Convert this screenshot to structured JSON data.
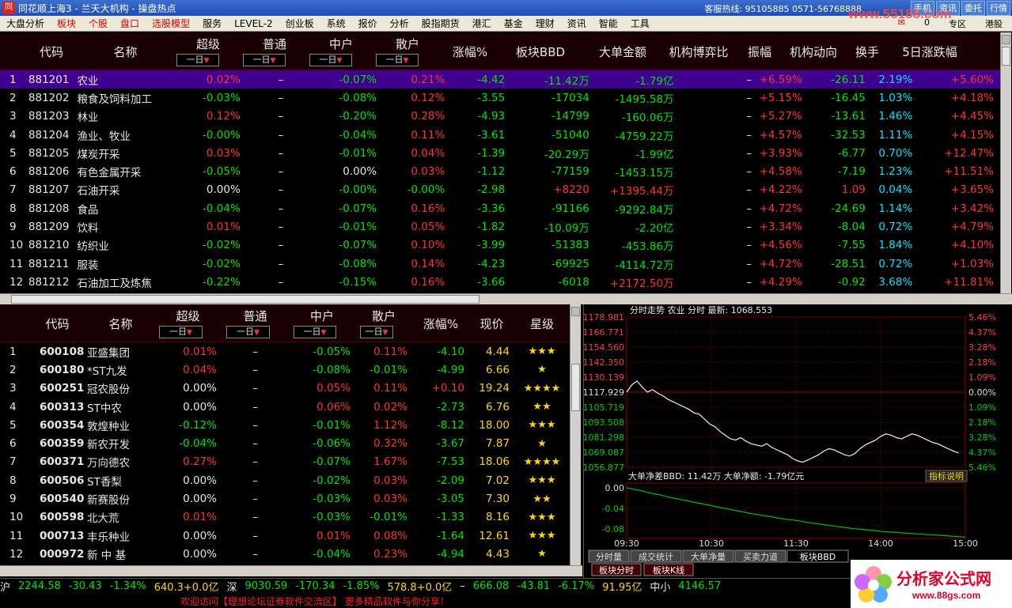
{
  "title": "同花顺上海3 - 兰天大机构 - 操盘热点",
  "hotline": "客服热线: 95105885   0571-56768888",
  "title_tabs": [
    "手机",
    "资讯",
    "委托",
    "行情"
  ],
  "menu": [
    "大盘分析",
    "板块",
    "个股",
    "盘口",
    "选股模型",
    "服务",
    "LEVEL-2",
    "创业板",
    "系统",
    "报价",
    "分析",
    "股指期货",
    "港汇",
    "基金",
    "理财",
    "资讯",
    "智能",
    "工具"
  ],
  "menu_red": [
    1,
    2,
    3,
    4
  ],
  "menu_right": [
    "0",
    "专区",
    "港股"
  ],
  "top_headers": [
    "代码",
    "名称",
    "超级",
    "普通",
    "中户",
    "散户",
    "涨幅%",
    "板块BBD",
    "大单金额",
    "机构博弈比",
    "振幅",
    "机构动向",
    "换手",
    "5日涨跌幅"
  ],
  "drop_label": "一日",
  "top_rows": [
    [
      "1",
      "881201",
      "农业",
      "0.02%",
      "–",
      "-0.07%",
      "0.21%",
      "-4.42",
      "-11.42万",
      "-1.79亿",
      "–",
      "+6.59%",
      "-26.11",
      "2.19%",
      "+5.60%"
    ],
    [
      "2",
      "881202",
      "粮食及饲料加工",
      "-0.03%",
      "–",
      "-0.08%",
      "0.12%",
      "-3.55",
      "-17034",
      "-1495.58万",
      "–",
      "+5.15%",
      "-16.45",
      "1.03%",
      "+4.18%"
    ],
    [
      "3",
      "881203",
      "林业",
      "0.12%",
      "–",
      "-0.20%",
      "0.28%",
      "-4.93",
      "-14799",
      "-160.06万",
      "–",
      "+5.27%",
      "-13.61",
      "1.46%",
      "+4.45%"
    ],
    [
      "4",
      "881204",
      "渔业、牧业",
      "-0.00%",
      "–",
      "-0.04%",
      "0.11%",
      "-3.61",
      "-51040",
      "-4759.22万",
      "–",
      "+4.57%",
      "-32.53",
      "1.11%",
      "+4.15%"
    ],
    [
      "5",
      "881205",
      "煤炭开采",
      "0.03%",
      "–",
      "-0.01%",
      "0.04%",
      "-1.39",
      "-20.29万",
      "-1.99亿",
      "–",
      "+3.93%",
      "-6.77",
      "0.70%",
      "+12.47%"
    ],
    [
      "6",
      "881206",
      "有色金属开采",
      "-0.05%",
      "–",
      "0.00%",
      "0.03%",
      "-1.12",
      "-77159",
      "-1453.15万",
      "–",
      "+4.58%",
      "-7.19",
      "1.23%",
      "+11.51%"
    ],
    [
      "7",
      "881207",
      "石油开采",
      "0.00%",
      "–",
      "-0.00%",
      "-0.00%",
      "-2.98",
      "+8220",
      "+1395.44万",
      "–",
      "+4.22%",
      "1.09",
      "0.04%",
      "+3.65%"
    ],
    [
      "8",
      "881208",
      "食品",
      "-0.04%",
      "–",
      "-0.07%",
      "0.16%",
      "-3.36",
      "-91166",
      "-9292.84万",
      "–",
      "+4.72%",
      "-24.69",
      "1.14%",
      "+3.42%"
    ],
    [
      "9",
      "881209",
      "饮料",
      "0.01%",
      "–",
      "-0.01%",
      "0.05%",
      "-1.82",
      "-10.09万",
      "-2.20亿",
      "–",
      "+3.34%",
      "-8.04",
      "0.72%",
      "+4.79%"
    ],
    [
      "10",
      "881210",
      "纺织业",
      "-0.02%",
      "–",
      "-0.07%",
      "0.10%",
      "-3.99",
      "-51383",
      "-453.86万",
      "–",
      "+4.56%",
      "-7.55",
      "1.84%",
      "+4.10%"
    ],
    [
      "11",
      "881211",
      "服装",
      "-0.02%",
      "–",
      "-0.08%",
      "0.14%",
      "-4.23",
      "-69925",
      "-4114.72万",
      "–",
      "+4.72%",
      "-28.51",
      "0.72%",
      "+1.03%"
    ],
    [
      "12",
      "881212",
      "石油加工及炼焦",
      "-0.22%",
      "–",
      "-0.15%",
      "0.16%",
      "-3.66",
      "-6018",
      "+2172.50万",
      "–",
      "+4.29%",
      "-0.92",
      "3.68%",
      "+11.81%"
    ]
  ],
  "bottom_headers": [
    "代码",
    "名称",
    "超级",
    "普通",
    "中户",
    "散户",
    "涨幅%",
    "现价",
    "星级"
  ],
  "bottom_rows": [
    [
      "1",
      "600108",
      "亚盛集团",
      "0.01%",
      "–",
      "-0.05%",
      "0.11%",
      "-4.10",
      "4.44",
      3
    ],
    [
      "2",
      "600180",
      "*ST九发",
      "0.04%",
      "–",
      "-0.08%",
      "-0.01%",
      "-4.99",
      "6.66",
      1
    ],
    [
      "3",
      "600251",
      "冠农股份",
      "0.00%",
      "–",
      "0.05%",
      "0.11%",
      "+0.10",
      "19.24",
      4
    ],
    [
      "4",
      "600313",
      "ST中农",
      "0.00%",
      "–",
      "0.06%",
      "0.02%",
      "-2.73",
      "6.76",
      2
    ],
    [
      "5",
      "600354",
      "敦煌种业",
      "-0.12%",
      "–",
      "-0.01%",
      "1.12%",
      "-8.12",
      "18.00",
      3
    ],
    [
      "6",
      "600359",
      "新农开发",
      "-0.04%",
      "–",
      "-0.06%",
      "0.32%",
      "-3.67",
      "7.87",
      1
    ],
    [
      "7",
      "600371",
      "万向德农",
      "0.27%",
      "–",
      "-0.07%",
      "1.67%",
      "-7.53",
      "18.06",
      4
    ],
    [
      "8",
      "600506",
      "ST香梨",
      "0.00%",
      "–",
      "-0.02%",
      "0.03%",
      "-2.09",
      "7.02",
      3
    ],
    [
      "9",
      "600540",
      "新赛股份",
      "0.00%",
      "–",
      "-0.03%",
      "0.03%",
      "-3.05",
      "7.30",
      2
    ],
    [
      "10",
      "600598",
      "北大荒",
      "0.01%",
      "–",
      "-0.03%",
      "-0.01%",
      "-1.33",
      "8.16",
      3
    ],
    [
      "11",
      "000713",
      "丰乐种业",
      "0.00%",
      "–",
      "0.01%",
      "0.08%",
      "-1.64",
      "12.61",
      3
    ],
    [
      "12",
      "000972",
      "新 中 基",
      "0.00%",
      "–",
      "-0.04%",
      "0.23%",
      "-4.94",
      "4.43",
      1
    ]
  ],
  "chart_header": "分时走势  农业 分时 最新: 1068.553",
  "chart_yleft": [
    "1178.981",
    "1166.771",
    "1154.560",
    "1142.350",
    "1130.139",
    "1117.929",
    "1105.719",
    "1093.508",
    "1081.298",
    "1069.087",
    "1056.877"
  ],
  "chart_yright": [
    "5.46%",
    "4.37%",
    "3.28%",
    "2.18%",
    "1.09%",
    "0.00%",
    "1.09%",
    "2.18%",
    "3.28%",
    "4.37%",
    "5.46%"
  ],
  "bbd_header": "大单净差BBD: 11.42万  大单净额: -1.79亿元",
  "bbd_button": "指标说明",
  "bbd_y": [
    "0.00",
    "-0.04",
    "-0.08"
  ],
  "chart_xlabels": [
    "09:30",
    "10:30",
    "11:30",
    "14:00",
    "15:00"
  ],
  "chart_tabs": [
    "分时量",
    "成交统计",
    "大单净量",
    "买卖力道",
    "板块BBD"
  ],
  "chart_tabs2": [
    "板块分时",
    "板块K线"
  ],
  "chart_data": {
    "type": "line",
    "title": "分时走势  农业 分时 最新: 1068.553",
    "x": [
      "09:30",
      "10:30",
      "11:30",
      "14:00",
      "15:00"
    ],
    "ylim": [
      1056.877,
      1178.981
    ],
    "series": [
      {
        "values": [
          1117.9,
          1124,
          1127,
          1122,
          1118,
          1120,
          1117,
          1115,
          1112,
          1110,
          1108,
          1106,
          1104,
          1101,
          1100,
          1096,
          1092,
          1090,
          1086,
          1083,
          1080,
          1079,
          1081,
          1078,
          1076,
          1075,
          1074,
          1076,
          1073,
          1071,
          1069,
          1067,
          1064,
          1062,
          1061,
          1063,
          1065,
          1067,
          1070,
          1072,
          1071,
          1069,
          1067,
          1066,
          1068,
          1072,
          1075,
          1077,
          1079,
          1082,
          1084,
          1083,
          1081,
          1080,
          1082,
          1084,
          1083,
          1081,
          1079,
          1077,
          1076,
          1074,
          1072,
          1070,
          1068.5
        ]
      }
    ]
  },
  "bbd_data": {
    "ylim": [
      -0.11,
      0.005
    ],
    "values": [
      0,
      -0.003,
      -0.006,
      -0.01,
      -0.013,
      -0.016,
      -0.02,
      -0.023,
      -0.026,
      -0.029,
      -0.032,
      -0.035,
      -0.038,
      -0.041,
      -0.044,
      -0.047,
      -0.05,
      -0.053,
      -0.056,
      -0.058,
      -0.061,
      -0.063,
      -0.066,
      -0.068,
      -0.07,
      -0.072,
      -0.075,
      -0.077,
      -0.079,
      -0.081,
      -0.083,
      -0.085,
      -0.087,
      -0.089,
      -0.09,
      -0.092,
      -0.093,
      -0.095,
      -0.096,
      -0.097,
      -0.098,
      -0.099,
      -0.1,
      -0.101,
      -0.102,
      -0.103,
      -0.104,
      -0.105,
      -0.106,
      -0.107
    ]
  },
  "status": [
    {
      "t": "沪",
      "c": "w"
    },
    {
      "t": "2244.58",
      "c": "g"
    },
    {
      "t": "-30.43",
      "c": "g"
    },
    {
      "t": "-1.34%",
      "c": "g"
    },
    {
      "t": "640.3+0.0亿",
      "c": "y"
    },
    {
      "t": "深",
      "c": "w"
    },
    {
      "t": "9030.59",
      "c": "g"
    },
    {
      "t": "-170.34",
      "c": "g"
    },
    {
      "t": "-1.85%",
      "c": "g"
    },
    {
      "t": "578.8+0.0亿",
      "c": "y"
    },
    {
      "t": "–",
      "c": "w"
    },
    {
      "t": "666.08",
      "c": "g"
    },
    {
      "t": "-43.81",
      "c": "g"
    },
    {
      "t": "-6.17%",
      "c": "g"
    },
    {
      "t": "91.95亿",
      "c": "y"
    },
    {
      "t": "中小",
      "c": "w"
    },
    {
      "t": "4146.57",
      "c": "g"
    }
  ],
  "message": "欢迎访问【理想论坛证券软件交流区】  更多精品软件与你分享！",
  "watermark": "www.55188.com",
  "ad_title": "分析家公式网",
  "ad_url": "www.88gs.com"
}
